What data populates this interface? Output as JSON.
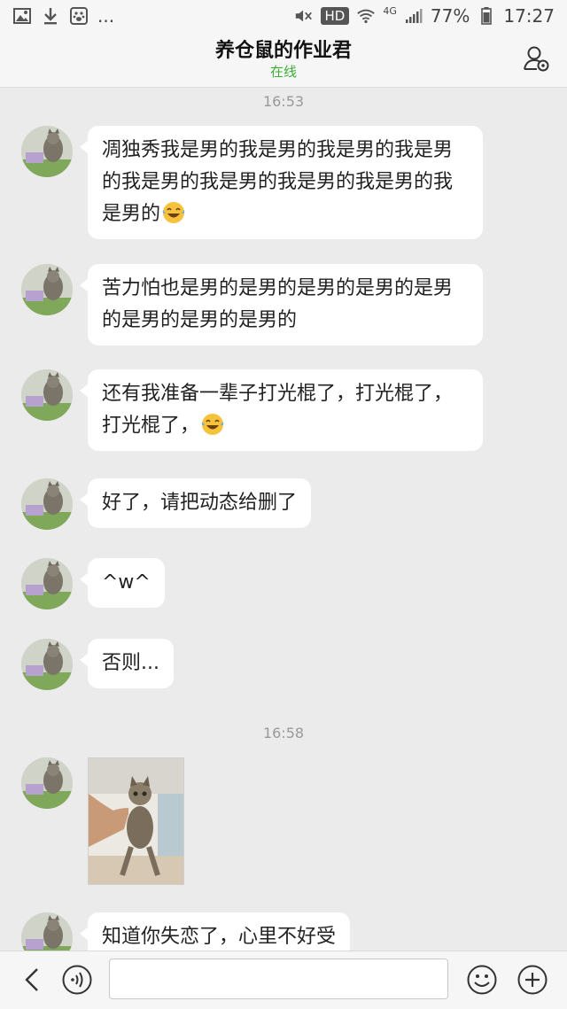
{
  "status_bar": {
    "dots": "...",
    "hd": "HD",
    "network": "4G",
    "battery": "77%",
    "time": "17:27",
    "icons": [
      "image-icon",
      "download-icon",
      "paw-icon",
      "mute-icon",
      "wifi-icon",
      "signal-icon",
      "battery-icon"
    ]
  },
  "header": {
    "title": "养仓鼠的作业君",
    "status": "在线",
    "profile_icon": "profile-settings-icon"
  },
  "chat": {
    "timestamps": [
      "16:53",
      "16:58"
    ],
    "messages": [
      {
        "type": "text",
        "text": "凋独秀我是男的我是男的我是男的我是男的我是男的我是男的我是男的我是男的我是男的",
        "emoji": "laughing-tears-emoji"
      },
      {
        "type": "text",
        "text": "苦力怕也是男的是男的是男的是男的是男的是男的是男的是男的"
      },
      {
        "type": "text",
        "text": "还有我准备一辈子打光棍了，打光棍了，打光棍了，",
        "emoji": "laughing-tears-emoji"
      },
      {
        "type": "text",
        "text": "好了，请把动态给删了"
      },
      {
        "type": "text",
        "text": "^w^"
      },
      {
        "type": "text",
        "text": "否则..."
      },
      {
        "type": "image",
        "alt": "cat photo"
      },
      {
        "type": "text",
        "text": "知道你失恋了，心里不好受"
      }
    ]
  },
  "input_bar": {
    "placeholder": "",
    "icons": [
      "back-icon",
      "voice-icon",
      "emoji-icon",
      "plus-icon"
    ]
  },
  "colors": {
    "background": "#ebebeb",
    "online_green": "#3cb034",
    "bubble": "#ffffff"
  }
}
